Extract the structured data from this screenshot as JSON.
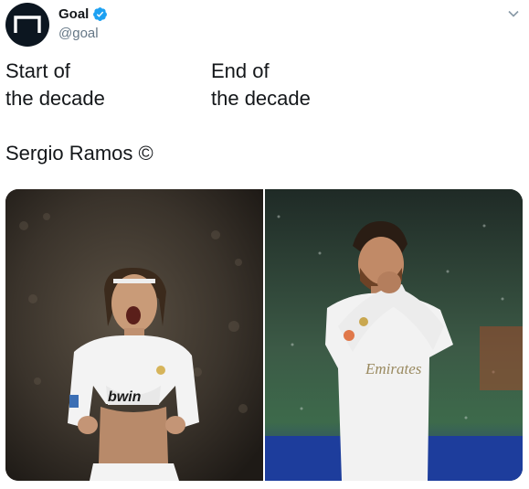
{
  "account": {
    "display_name": "Goal",
    "handle": "@goal",
    "verified": true,
    "avatar_icon": "goal-logo-icon",
    "avatar_bg": "#0c1620"
  },
  "tweet": {
    "col_left": [
      "Start of",
      "the decade"
    ],
    "col_right": [
      "End of",
      "the decade"
    ],
    "footer": "Sergio Ramos ©"
  },
  "media": {
    "images": [
      {
        "name": "ramos-start-decade-photo",
        "jersey_text": "bwin"
      },
      {
        "name": "ramos-end-decade-photo",
        "jersey_text": "Emirates"
      }
    ]
  },
  "colors": {
    "verified_blue": "#1da1f2",
    "text": "#14171a",
    "muted": "#657786"
  }
}
